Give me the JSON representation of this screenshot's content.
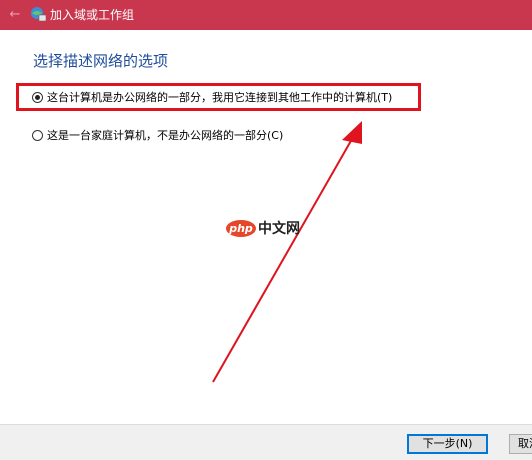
{
  "window": {
    "title": "加入域或工作组",
    "back_icon": "back-arrow-icon",
    "title_icon": "network-globe-icon",
    "titlebar_color": "#c8374e"
  },
  "main": {
    "heading": "选择描述网络的选项",
    "options": [
      {
        "label": "这台计算机是办公网络的一部分，我用它连接到其他工作中的计算机(T)",
        "selected": true
      },
      {
        "label": "这是一台家庭计算机，不是办公网络的一部分(C)",
        "selected": false
      }
    ]
  },
  "watermark": {
    "logo": "php",
    "text": "中文网"
  },
  "annotation": {
    "highlight_color": "#e0141e"
  },
  "footer": {
    "next_label": "下一步(N)",
    "cancel_label": "取消"
  }
}
